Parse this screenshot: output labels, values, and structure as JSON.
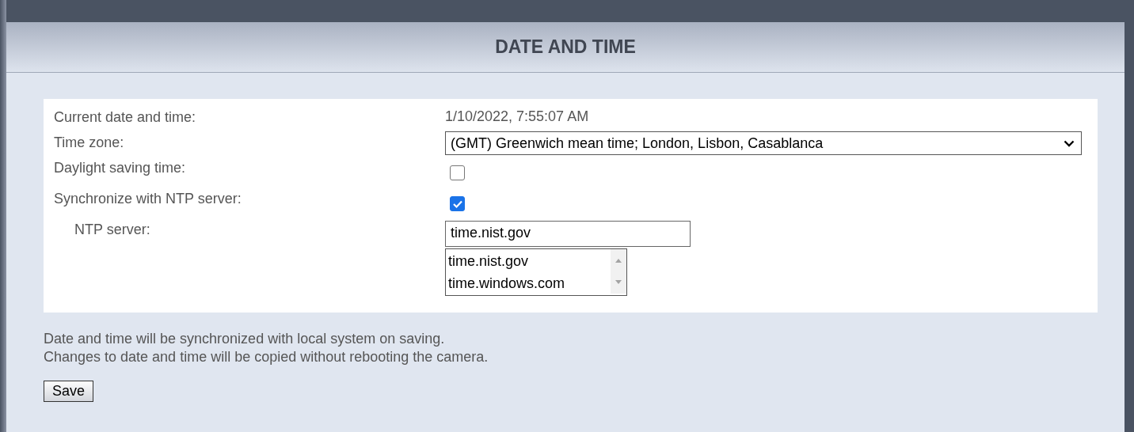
{
  "title": "DATE AND TIME",
  "rows": [
    {
      "kind": "text",
      "label": "Current date and time:",
      "value": "1/10/2022, 7:55:07 AM"
    },
    {
      "kind": "select",
      "label": "Time zone:",
      "value": "(GMT) Greenwich mean time; London, Lisbon, Casablanca"
    },
    {
      "kind": "checkbox",
      "label": "Daylight saving time:",
      "checked": false
    },
    {
      "kind": "checkbox",
      "label": "Synchronize with NTP server:",
      "checked": true
    },
    {
      "kind": "input",
      "label": "NTP server:",
      "value": "time.nist.gov",
      "options": [
        "time.nist.gov",
        "time.windows.com"
      ]
    }
  ],
  "notes": [
    "Date and time will be synchronized with local system on saving.",
    "Changes to date and time will be copied without rebooting the camera."
  ],
  "save_button": "Save"
}
